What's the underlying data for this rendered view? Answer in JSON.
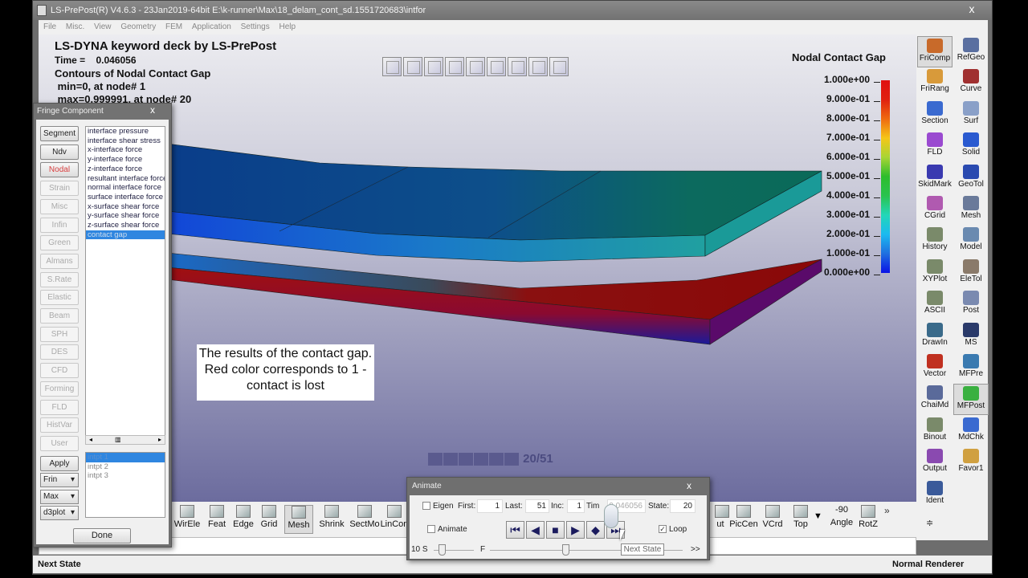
{
  "window": {
    "title": "LS-PrePost(R) V4.6.3 - 23Jan2019-64bit E:\\k-runner\\Max\\18_delam_cont_sd.1551720683\\intfor",
    "close_label": "x"
  },
  "menu": [
    "File",
    "Misc.",
    "View",
    "Geometry",
    "FEM",
    "Application",
    "Settings",
    "Help"
  ],
  "viewport": {
    "header_title": "LS-DYNA keyword deck by LS-PrePost",
    "time_line": "Time =    0.046056",
    "contour_line": "Contours of Nodal Contact Gap",
    "min_line": " min=0, at node# 1",
    "max_line": " max=0.999991, at node# 20",
    "annotation": "The results of the contact gap.  Red color corresponds to 1 - contact is lost",
    "state_counter": "20/51",
    "view_cube_icons": [
      "view-iso-1",
      "view-iso-2",
      "view-front",
      "view-back",
      "view-left",
      "view-right",
      "view-top",
      "view-bottom",
      "view-reset"
    ]
  },
  "legend": {
    "title": "Nodal Contact Gap",
    "labels": [
      "1.000e+00",
      "9.000e-01",
      "8.000e-01",
      "7.000e-01",
      "6.000e-01",
      "5.000e-01",
      "4.000e-01",
      "3.000e-01",
      "2.000e-01",
      "1.000e-01",
      "0.000e+00"
    ],
    "colors": [
      "#e01010",
      "#e83a10",
      "#ef6a10",
      "#f5c617",
      "#a8d534",
      "#2dbd2c",
      "#2ac34f",
      "#22d7b8",
      "#1bbaf0",
      "#1f6fe0",
      "#0a12e6"
    ],
    "range": [
      0,
      1
    ]
  },
  "fringe_dialog": {
    "title": "Fringe Component",
    "close_label": "x",
    "categories": [
      {
        "label": "Segment",
        "state": "enabled"
      },
      {
        "label": "Ndv",
        "state": "enabled"
      },
      {
        "label": "Nodal",
        "state": "selected"
      },
      {
        "label": "Strain",
        "state": "disabled"
      },
      {
        "label": "Misc",
        "state": "disabled"
      },
      {
        "label": "Infin",
        "state": "disabled"
      },
      {
        "label": "Green",
        "state": "disabled"
      },
      {
        "label": "Almans",
        "state": "disabled"
      },
      {
        "label": "S.Rate",
        "state": "disabled"
      },
      {
        "label": "Elastic",
        "state": "disabled"
      },
      {
        "label": "Beam",
        "state": "disabled"
      },
      {
        "label": "SPH",
        "state": "disabled"
      },
      {
        "label": "DES",
        "state": "disabled"
      },
      {
        "label": "CFD",
        "state": "disabled"
      },
      {
        "label": "Forming",
        "state": "disabled"
      },
      {
        "label": "FLD",
        "state": "disabled"
      },
      {
        "label": "HistVar",
        "state": "disabled"
      },
      {
        "label": "User",
        "state": "disabled"
      }
    ],
    "components": [
      "interface pressure",
      "interface shear stress",
      "x-interface force",
      "y-interface force",
      "z-interface force",
      "resultant interface force",
      "normal interface force",
      "surface interface force",
      "x-surface shear force",
      "y-surface shear force",
      "z-surface shear force",
      "contact gap"
    ],
    "selected_component": "contact gap",
    "apply_label": "Apply",
    "dropdowns": [
      "Frin",
      "Max",
      "d3plot"
    ],
    "integration_points": [
      "intpt   1",
      "intpt   2",
      "intpt   3"
    ],
    "selected_intpt": "intpt   1",
    "done_label": "Done"
  },
  "right_toolbar": [
    {
      "label": "FriComp",
      "icon": "fringe-component-icon",
      "color": "#c86a2a",
      "active": true
    },
    {
      "label": "RefGeo",
      "icon": "reference-geometry-icon",
      "color": "#5a6fa0"
    },
    {
      "label": "FriRang",
      "icon": "fringe-range-icon",
      "color": "#d89a3a"
    },
    {
      "label": "Curve",
      "icon": "curve-icon",
      "color": "#a03030"
    },
    {
      "label": "Section",
      "icon": "section-icon",
      "color": "#3a6ad0"
    },
    {
      "label": "Surf",
      "icon": "surface-icon",
      "color": "#8aa0c8"
    },
    {
      "label": "FLD",
      "icon": "fld-icon",
      "color": "#9a4ad0"
    },
    {
      "label": "Solid",
      "icon": "solid-icon",
      "color": "#2a5ad0"
    },
    {
      "label": "SkidMark",
      "icon": "skidmark-icon",
      "color": "#3a3ab0"
    },
    {
      "label": "GeoTol",
      "icon": "geometry-tool-icon",
      "color": "#2a4ab0"
    },
    {
      "label": "CGrid",
      "icon": "circle-grid-icon",
      "color": "#b05ab0"
    },
    {
      "label": "Mesh",
      "icon": "mesh-icon",
      "color": "#6a7a9a"
    },
    {
      "label": "History",
      "icon": "history-plot-icon",
      "color": "#7a8a6a"
    },
    {
      "label": "Model",
      "icon": "model-icon",
      "color": "#6a8ab0"
    },
    {
      "label": "XYPlot",
      "icon": "xy-plot-icon",
      "color": "#7a8a6a"
    },
    {
      "label": "EleTol",
      "icon": "element-tool-icon",
      "color": "#8a7a6a"
    },
    {
      "label": "ASCII",
      "icon": "ascii-icon",
      "color": "#7a8a6a"
    },
    {
      "label": "Post",
      "icon": "post-icon",
      "color": "#7a8ab0"
    },
    {
      "label": "DrawIn",
      "icon": "draw-in-icon",
      "color": "#3a6a8a"
    },
    {
      "label": "MS",
      "icon": "ms-icon",
      "color": "#2a3a6a"
    },
    {
      "label": "Vector",
      "icon": "vector-icon",
      "color": "#c03020"
    },
    {
      "label": "MFPre",
      "icon": "mf-pre-icon",
      "color": "#3a7ab0"
    },
    {
      "label": "ChaiMd",
      "icon": "chain-model-icon",
      "color": "#5a6a9a"
    },
    {
      "label": "MFPost",
      "icon": "mf-post-icon",
      "color": "#3ab040",
      "active": true
    },
    {
      "label": "Binout",
      "icon": "binout-icon",
      "color": "#7a8a6a"
    },
    {
      "label": "MdChk",
      "icon": "model-check-icon",
      "color": "#3a6ad0"
    },
    {
      "label": "Output",
      "icon": "output-icon",
      "color": "#8a4ab0"
    },
    {
      "label": "Favor1",
      "icon": "favorite-icon",
      "color": "#d0a040"
    },
    {
      "label": "Ident",
      "icon": "identify-icon",
      "color": "#3a5a9a"
    }
  ],
  "bottom_toolbar": [
    {
      "label": "WirEle",
      "icon": "wire-element-icon"
    },
    {
      "label": "Feat",
      "icon": "feature-line-icon"
    },
    {
      "label": "Edge",
      "icon": "edge-icon"
    },
    {
      "label": "Grid",
      "icon": "grid-icon"
    },
    {
      "label": "Mesh",
      "icon": "mesh-display-icon",
      "active": true
    },
    {
      "label": "Shrink",
      "icon": "shrink-icon"
    },
    {
      "label": "SectMo",
      "icon": "section-mode-icon"
    },
    {
      "label": "LinCon",
      "icon": "line-contour-icon"
    },
    {
      "label": "ut",
      "icon": "cut-icon"
    },
    {
      "label": "PicCen",
      "icon": "pick-center-icon"
    },
    {
      "label": "VCrd",
      "icon": "view-coordinate-icon"
    },
    {
      "label": "Top",
      "icon": "top-view-icon"
    },
    {
      "label": "-90",
      "sublabel": "Angle",
      "icon": "angle-value"
    },
    {
      "label": "RotZ",
      "icon": "rotate-z-icon"
    }
  ],
  "bottom_toolbar_more": "»",
  "animate_dialog": {
    "title": "Animate",
    "close_label": "x",
    "eigen_label": "Eigen",
    "eigen_checked": false,
    "first_label": "First:",
    "first_value": "1",
    "last_label": "Last:",
    "last_value": "51",
    "inc_label": "Inc:",
    "inc_value": "1",
    "time_label": "Tim",
    "time_value": "0.046056",
    "state_label": "State:",
    "state_value": "20",
    "animate_label": "Animate",
    "animate_checked": false,
    "loop_label": "Loop",
    "loop_checked": true,
    "speed_label_left": "10 S",
    "speed_label_right": "F",
    "more_label": ">>",
    "speed_slider_fraction": 0.2,
    "frame_slider_fraction": 0.39,
    "tooltip": "Next State"
  },
  "status": {
    "left": "Next State",
    "right": "Normal Renderer"
  }
}
